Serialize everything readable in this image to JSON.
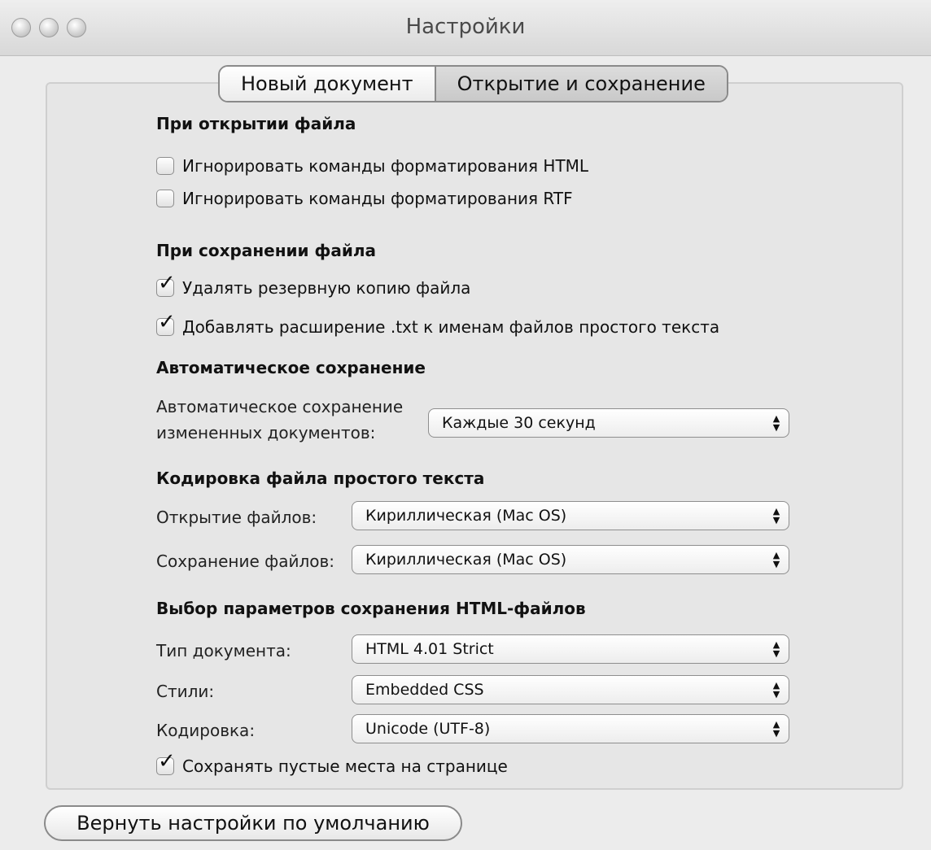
{
  "window": {
    "title": "Настройки"
  },
  "tabs": [
    {
      "label": "Новый документ"
    },
    {
      "label": "Открытие и сохранение",
      "active": true
    }
  ],
  "open_file": {
    "heading": "При открытии файла",
    "ignore_html": {
      "label": "Игнорировать команды форматирования HTML",
      "checked": false
    },
    "ignore_rtf": {
      "label": "Игнорировать команды форматирования RTF",
      "checked": false
    }
  },
  "save_file": {
    "heading": "При сохранении файла",
    "delete_backup": {
      "label": "Удалять резервную копию файла",
      "checked": true
    },
    "add_txt_ext": {
      "label": "Добавлять расширение .txt к именам файлов простого текста",
      "checked": true
    }
  },
  "autosave": {
    "heading": "Автоматическое сохранение",
    "label_line1": "Автоматическое сохранение",
    "label_line2": "измененных документов:",
    "value": "Каждые 30 секунд"
  },
  "encoding": {
    "heading": "Кодировка файла простого текста",
    "open_label": "Открытие файлов:",
    "open_value": "Кириллическая (Mac OS)",
    "save_label": "Сохранение файлов:",
    "save_value": "Кириллическая (Mac OS)"
  },
  "html_options": {
    "heading": "Выбор параметров сохранения HTML-файлов",
    "doc_type_label": "Тип документа:",
    "doc_type_value": "HTML 4.01 Strict",
    "styles_label": "Стили:",
    "styles_value": "Embedded CSS",
    "encoding_label": "Кодировка:",
    "encoding_value": "Unicode (UTF-8)",
    "preserve_whitespace": {
      "label": "Сохранять пустые места на странице",
      "checked": true
    }
  },
  "reset_button": {
    "label": "Вернуть настройки по умолчанию"
  },
  "icons": {
    "checkmark": "✓",
    "popup_arrows": "▲▼"
  }
}
